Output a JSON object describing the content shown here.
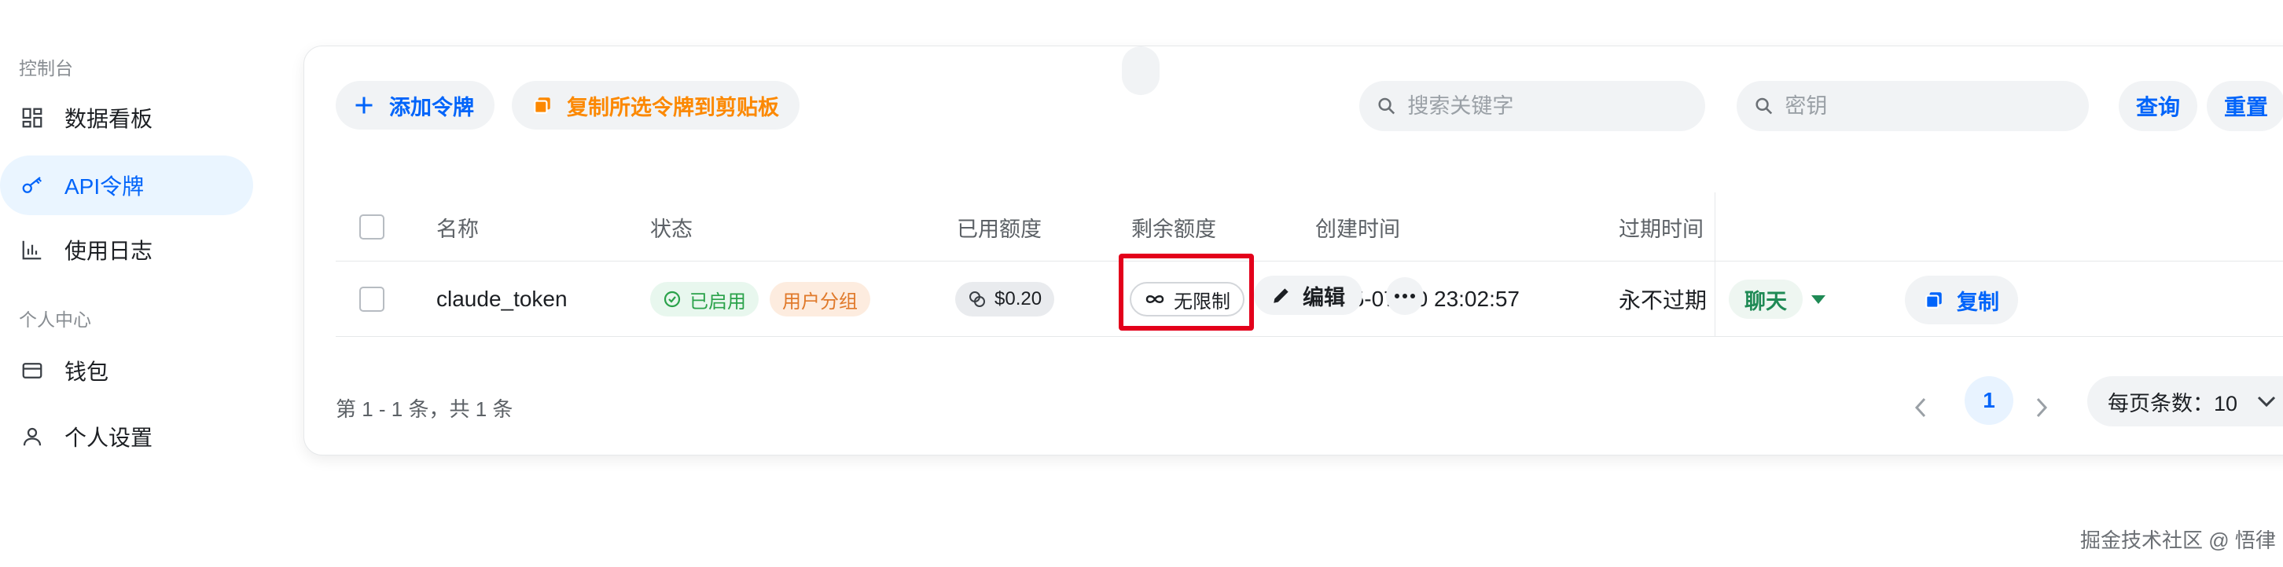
{
  "sidebar": {
    "section_console": "控制台",
    "section_personal": "个人中心",
    "items": [
      {
        "label": "数据看板",
        "icon": "dashboard-grid-icon"
      },
      {
        "label": "API令牌",
        "icon": "key-icon"
      },
      {
        "label": "使用日志",
        "icon": "bar-chart-icon"
      },
      {
        "label": "钱包",
        "icon": "wallet-card-icon"
      },
      {
        "label": "个人设置",
        "icon": "user-icon"
      }
    ]
  },
  "toolbar": {
    "add_label": "添加令牌",
    "copy_selected_label": "复制所选令牌到剪贴板",
    "keyword_placeholder": "搜索关键字",
    "key_placeholder": "密钥",
    "query_label": "查询",
    "reset_label": "重置"
  },
  "table": {
    "columns": [
      "名称",
      "状态",
      "已用额度",
      "剩余额度",
      "创建时间",
      "过期时间"
    ],
    "rows": [
      {
        "name": "claude_token",
        "status": "已启用",
        "group": "用户分组",
        "used": "$0.20",
        "remaining": "无限制",
        "created": "2025-07-10 23:02:57",
        "expires": "永不过期",
        "actions": {
          "chat": "聊天",
          "copy": "复制",
          "edit": "编辑"
        }
      }
    ]
  },
  "pagination": {
    "info": "第 1 - 1 条，共 1 条",
    "current_page": "1",
    "page_size_label": "每页条数：10"
  },
  "watermark": "掘金技术社区 @ 悟律",
  "colors": {
    "accent": "#0064fa",
    "orange": "#fc8800",
    "highlight": "#e3001b",
    "status_green": "#2aa24a"
  }
}
